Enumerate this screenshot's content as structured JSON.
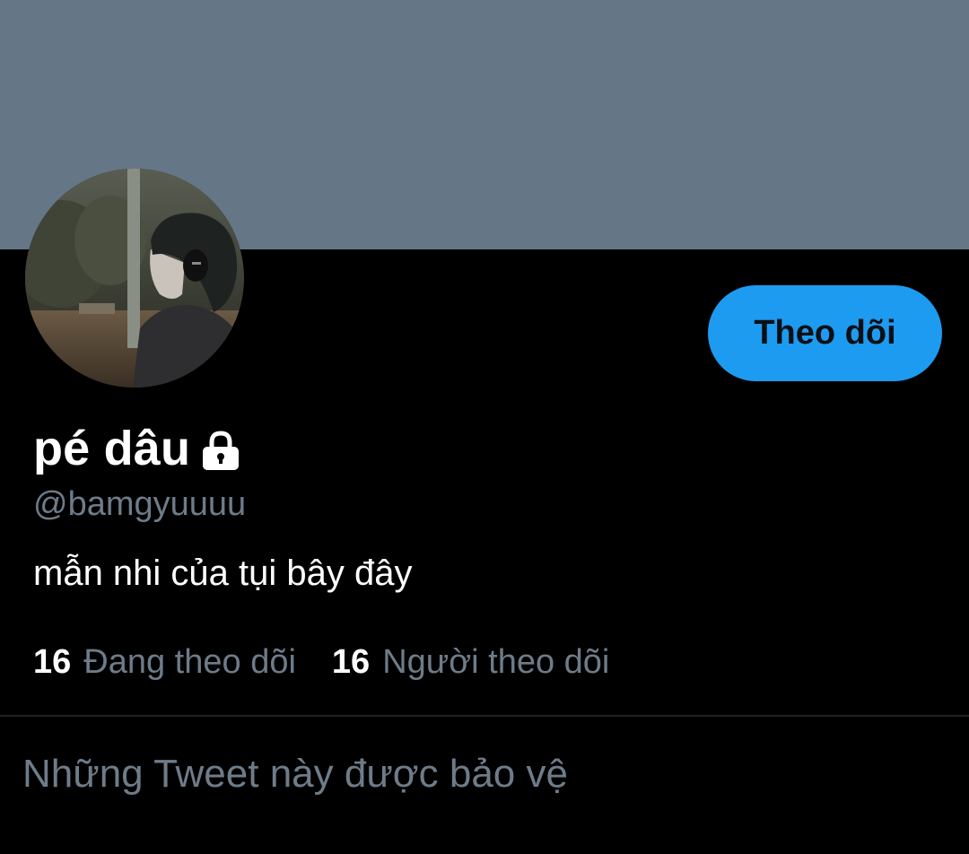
{
  "colors": {
    "banner": "#657786",
    "background": "#000000",
    "accent": "#1d9bf0",
    "follow_button_text": "#0b0f14",
    "secondary_text": "#6e7c89",
    "primary_text": "#ffffff"
  },
  "profile": {
    "display_name": "pé dâu",
    "lock_icon": "lock-icon",
    "handle": "@bamgyuuuu",
    "bio": "mẫn nhi của tụi bây đây",
    "avatar_description": "profile-photo"
  },
  "actions": {
    "follow_label": "Theo dõi"
  },
  "stats": {
    "following_count": "16",
    "following_label": "Đang theo dõi",
    "followers_count": "16",
    "followers_label": "Người theo dõi"
  },
  "notice": {
    "protected_text": "Những Tweet này được bảo vệ"
  }
}
